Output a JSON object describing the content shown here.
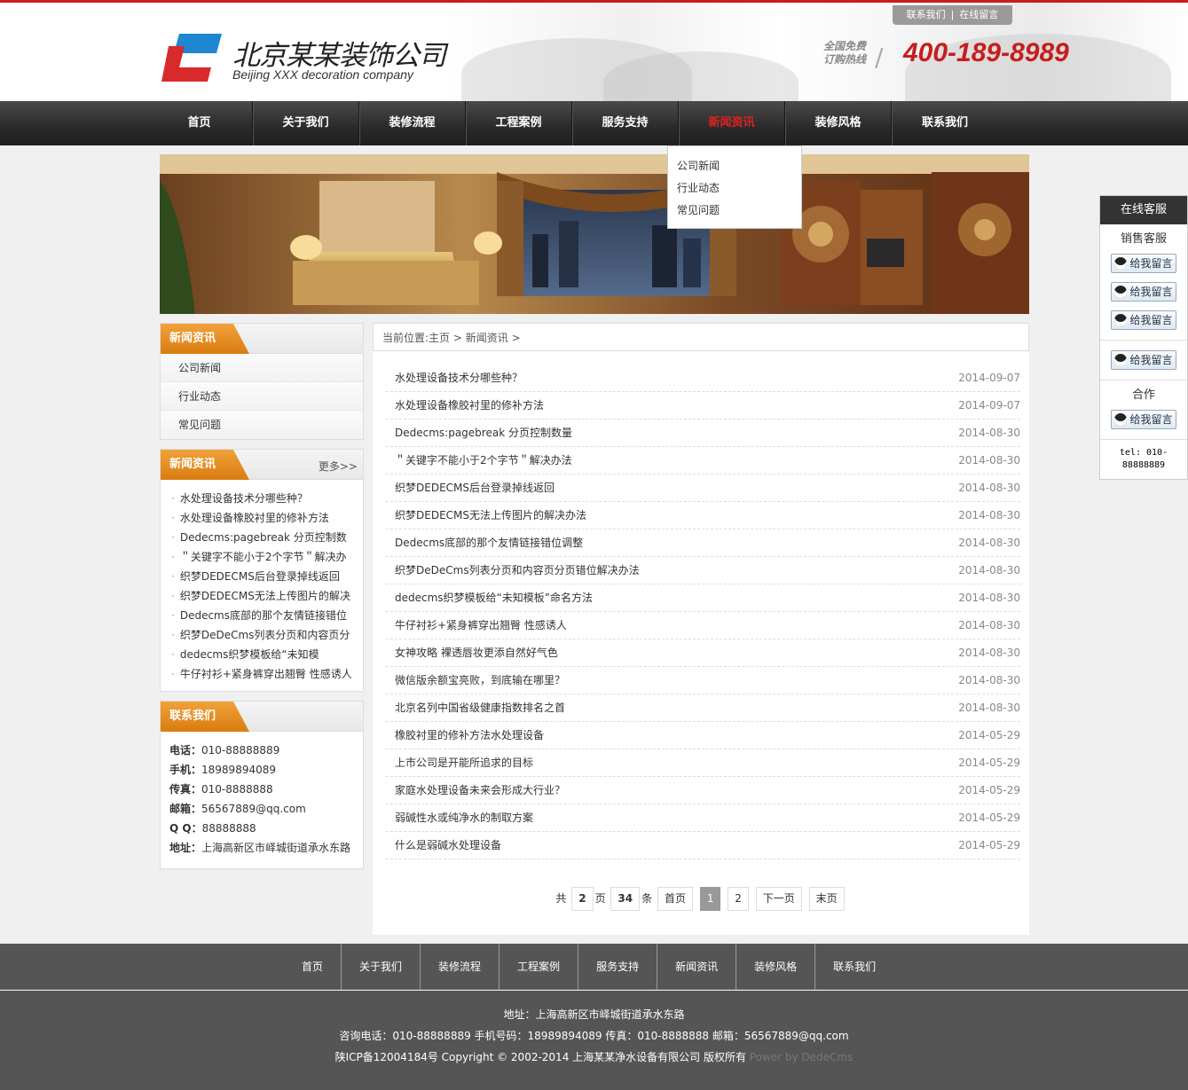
{
  "header": {
    "logo_cn": "北京某某装饰公司",
    "logo_en": "Beijing XXX decoration company",
    "top_links": [
      "联系我们",
      "在线留言"
    ],
    "hotline_label_1": "全国免费",
    "hotline_label_2": "订购热线",
    "hotline_number": "400-189-8989"
  },
  "nav": {
    "items": [
      "首页",
      "关于我们",
      "装修流程",
      "工程案例",
      "服务支持",
      "新闻资讯",
      "装修风格",
      "联系我们"
    ],
    "active": "新闻资讯",
    "dropdown": [
      "公司新闻",
      "行业动态",
      "常见问题"
    ]
  },
  "sidebar": {
    "categories_title": "新闻资讯",
    "categories": [
      "公司新闻",
      "行业动态",
      "常见问题"
    ],
    "news_title": "新闻资讯",
    "news_more": "更多>>",
    "news": [
      "水处理设备技术分哪些种？",
      "水处理设备橡胶衬里的修补方法",
      "Dedecms:pagebreak 分页控制数",
      "＂关键字不能小于2个字节＂解决办",
      "织梦DEDECMS后台登录掉线返回",
      "织梦DEDECMS无法上传图片的解决",
      "Dedecms底部的那个友情链接错位",
      "织梦DeDeCms列表分页和内容页分",
      "dedecms织梦模板给“未知模",
      "牛仔衬衫+紧身裤穿出翘臀 性感诱人"
    ],
    "contact_title": "联系我们",
    "contact": [
      {
        "label": "电话：",
        "value": "010-88888889"
      },
      {
        "label": "手机：",
        "value": "18989894089"
      },
      {
        "label": "传真：",
        "value": "010-8888888"
      },
      {
        "label": "邮箱：",
        "value": "56567889@qq.com"
      },
      {
        "label": "Q Q：",
        "value": "88888888"
      },
      {
        "label": "地址：",
        "value": "上海高新区市峄城街道承水东路"
      }
    ]
  },
  "breadcrumb": {
    "prefix": "当前位置:",
    "home": "主页",
    "sep": " > ",
    "section": "新闻资讯",
    "tail": " >"
  },
  "articles": [
    {
      "title": "水处理设备技术分哪些种？",
      "date": "2014-09-07"
    },
    {
      "title": "水处理设备橡胶衬里的修补方法",
      "date": "2014-09-07"
    },
    {
      "title": "Dedecms:pagebreak 分页控制数量",
      "date": "2014-08-30"
    },
    {
      "title": "＂关键字不能小于2个字节＂解决办法",
      "date": "2014-08-30"
    },
    {
      "title": "织梦DEDECMS后台登录掉线返回",
      "date": "2014-08-30"
    },
    {
      "title": "织梦DEDECMS无法上传图片的解决办法",
      "date": "2014-08-30"
    },
    {
      "title": "Dedecms底部的那个友情链接错位调整",
      "date": "2014-08-30"
    },
    {
      "title": "织梦DeDeCms列表分页和内容页分页错位解决办法",
      "date": "2014-08-30"
    },
    {
      "title": "dedecms织梦模板给“未知模板”命名方法",
      "date": "2014-08-30"
    },
    {
      "title": "牛仔衬衫+紧身裤穿出翘臀 性感诱人",
      "date": "2014-08-30"
    },
    {
      "title": "女神攻略 裸透唇妆更添自然好气色",
      "date": "2014-08-30"
    },
    {
      "title": "微信版余额宝亮败，到底输在哪里？",
      "date": "2014-08-30"
    },
    {
      "title": "北京名列中国省级健康指数排名之首",
      "date": "2014-08-30"
    },
    {
      "title": "橡胶衬里的修补方法水处理设备",
      "date": "2014-05-29"
    },
    {
      "title": "上市公司是开能所追求的目标",
      "date": "2014-05-29"
    },
    {
      "title": "家庭水处理设备未来会形成大行业？",
      "date": "2014-05-29"
    },
    {
      "title": "弱碱性水或纯净水的制取方案",
      "date": "2014-05-29"
    },
    {
      "title": "什么是弱碱水处理设备",
      "date": "2014-05-29"
    }
  ],
  "pager": {
    "total_prefix": "共",
    "pages": "2",
    "pages_unit": "页",
    "records": "34",
    "records_unit": "条",
    "first": "首页",
    "current": "1",
    "page2": "2",
    "next": "下一页",
    "last": "末页"
  },
  "service": {
    "title": "在线客服",
    "sales_label": "销售客服",
    "qq_label": "给我留言",
    "coop_label": "合作",
    "tel": "tel: 010-88888889"
  },
  "footer": {
    "nav": [
      "首页",
      "关于我们",
      "装修流程",
      "工程案例",
      "服务支持",
      "新闻资讯",
      "装修风格",
      "联系我们"
    ],
    "address": "地址：上海高新区市峄城街道承水东路",
    "phones": "咨询电话：010-88888889 手机号码：18989894089 传真：010-8888888 邮箱：56567889@qq.com",
    "copyright": "陕ICP备12004184号 Copyright © 2002-2014 上海某某净水设备有限公司 版权所有",
    "power": "Power by DedeCms"
  },
  "colors": {
    "brand_red": "#c71d1d",
    "accent_orange": "#e08a1e",
    "nav_dark": "#2a2a2a",
    "footer_gray": "#555555"
  }
}
